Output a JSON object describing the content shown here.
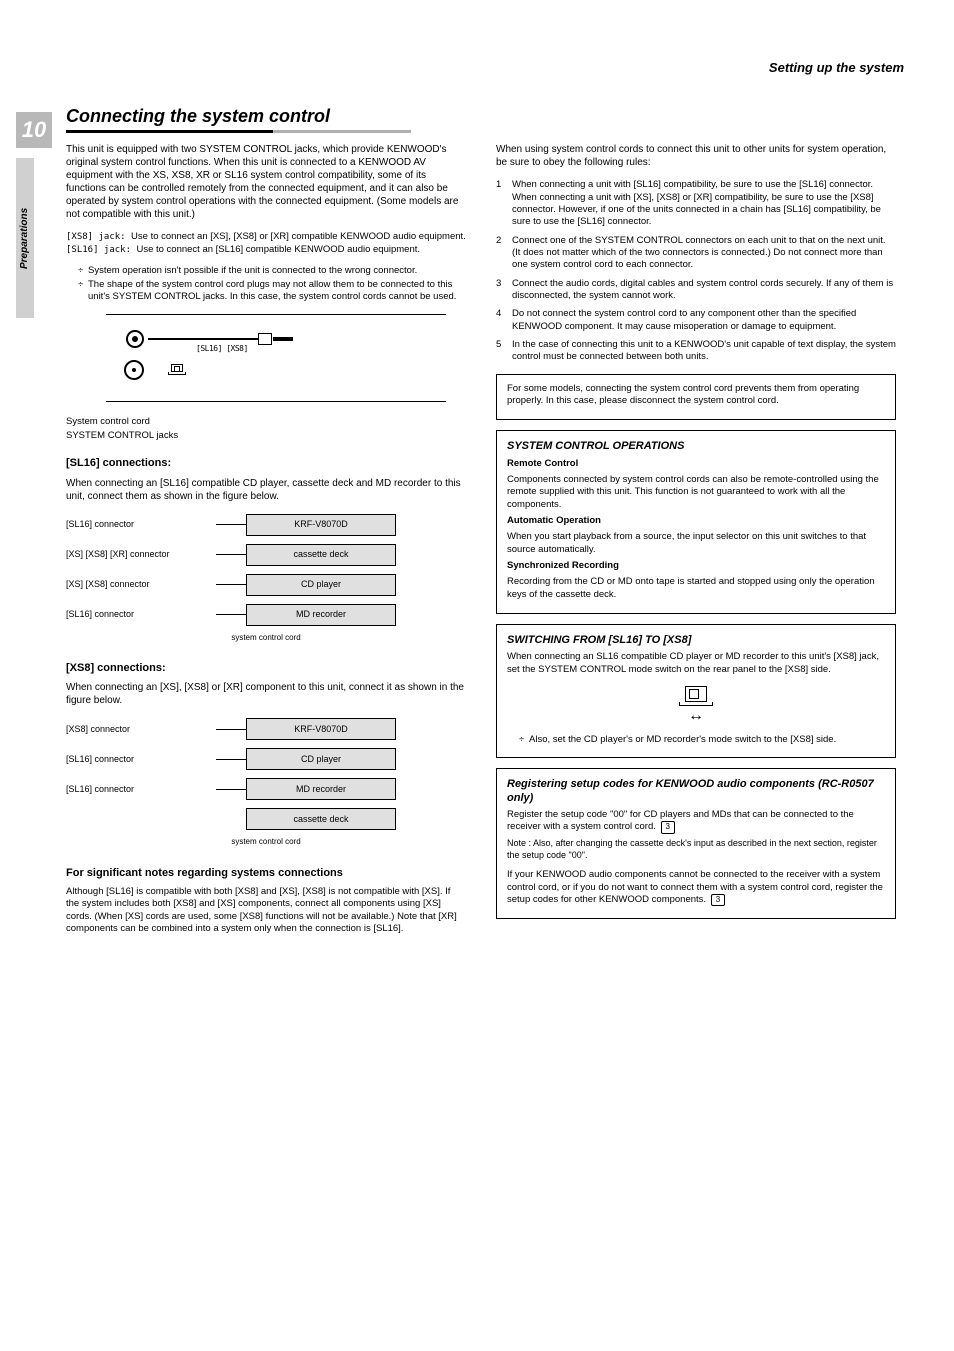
{
  "header": {
    "section_name": "Setting up the system"
  },
  "page_number": "10",
  "sidebar_tab": "Preparations",
  "title": "Connecting the system control",
  "left_col": {
    "intro": "This unit is equipped with two SYSTEM CONTROL jacks, which provide KENWOOD's original system control functions. When this unit is connected to a KENWOOD AV equipment with the XS, XS8, XR or SL16 system control compatibility, some of its functions can be controlled remotely from the connected equipment, and it can also be operated by system control operations with the connected equipment. (Some models are not compatible with this unit.)",
    "jack1_label": "[XS8] jack: ",
    "jack1_text": "Use to connect an [XS], [XS8] or [XR] compatible KENWOOD audio equipment.",
    "jack2_label": "[SL16] jack: ",
    "jack2_text": "Use to connect an [SL16] compatible KENWOOD audio equipment.",
    "jack_bullet1": "System operation isn't possible if the unit is connected to the wrong connector.",
    "jack_bullet2": "The shape of the system control cord plugs may not allow them to be connected to this unit's SYSTEM CONTROL jacks. In this case, the system control cords cannot be used.",
    "fig_jackbox": "[SL16] [XS8]",
    "fig_caption": "System control cord",
    "fig_label": "SYSTEM CONTROL jacks",
    "sl16_title": "[SL16] connections:",
    "sl16_intro": "When connecting an [SL16] compatible CD player, cassette deck and MD recorder to this unit, connect them as shown in the figure below.",
    "sl16_r1_label": "[SL16] connector",
    "sl16_r1_box": "KRF-V8070D",
    "sl16_r2_label1": "[XS] [XS8] [XR]",
    "sl16_r2_label2": " connector",
    "sl16_r2_box": "cassette deck",
    "sl16_r3_label1": "[XS] [XS8]",
    "sl16_r3_label2": " connector",
    "sl16_r3_box": "CD player",
    "sl16_r4_label": "[SL16] connector",
    "sl16_r4_box": "MD recorder",
    "sl16_tiny": "system control cord",
    "xs8_title": "[XS8] connections:",
    "xs8_intro": "When connecting an [XS], [XS8] or [XR] component to this unit, connect it as shown in the figure below.",
    "xs8_r1_label": "[XS8] connector",
    "xs8_r1_box": "KRF-V8070D",
    "xs8_r2_label": "[SL16] connector",
    "xs8_r2_box": "CD player",
    "xs8_r3_label": "[SL16] connector",
    "xs8_r3_box": "MD recorder",
    "xs8_r4_box": "cassette deck",
    "sig_sub": "For significant notes regarding systems connections",
    "sig_text": "Although [SL16] is compatible with both [XS8] and [XS], [XS8] is not compatible with [XS]. If the system includes both [XS8] and [XS] components, connect all components using [XS] cords. (When [XS] cords are used, some [XS8] functions will not be available.) Note that [XR] components can be combined into a system only when the connection is [SL16]."
  },
  "right_col": {
    "rules_intro": "When using system control cords to connect this unit to other units for system operation, be sure to obey the following rules:",
    "rule1_num": "1",
    "rule1": "When connecting a unit with [SL16] compatibility, be sure to use the [SL16] connector. When connecting a unit with [XS], [XS8] or [XR] compatibility, be sure to use the [XS8] connector. However, if one of the units connected in a chain has [SL16] compatibility, be sure to use the [SL16] connector.",
    "rule2_num": "2",
    "rule2": "Connect one of the SYSTEM CONTROL connectors on each unit to that on the next unit. (It does not matter which of the two connectors is connected.) Do not connect more than one system control cord to each connector.",
    "rule3_num": "3",
    "rule3": "Connect the audio cords, digital cables and system control cords securely. If any of them is disconnected, the system cannot work.",
    "rule4_num": "4",
    "rule4": "Do not connect the system control cord to any component other than the specified KENWOOD component. It may cause misoperation or damage to equipment.",
    "rule5_num": "5",
    "rule5": "In the case of connecting this unit to a KENWOOD's unit capable of text display, the system control must be connected between both units.",
    "short_box": "For some models, connecting the system control cord prevents them from operating properly. In this case, please disconnect the system control cord.",
    "sysop_title": "SYSTEM CONTROL OPERATIONS",
    "sysop_remote_h": "Remote Control",
    "sysop_remote": "Components connected by system control cords can also be remote-controlled using the remote supplied with this unit. This function is not guaranteed to work with all the components.",
    "sysop_auto_h": "Automatic Operation",
    "sysop_auto": "When you start playback from a source, the input selector on this unit switches to that source automatically.",
    "sysop_sync_h": "Synchronized Recording",
    "sysop_sync": "Recording from the CD or MD onto tape is started and stopped using only the operation keys of the cassette deck.",
    "switch_title": "SWITCHING FROM [SL16] TO [XS8]",
    "switch_text1": "When connecting an SL16 compatible CD player or MD recorder to this unit's [XS8] jack, set the SYSTEM CONTROL mode switch on the rear panel to the [XS8] side.",
    "switch_text2": "Also, set the CD player's or MD recorder's mode switch to the [XS8] side.",
    "reg_title": "Registering setup codes for KENWOOD audio components (RC-R0507 only)",
    "reg_p1": "Register the setup code \"00\" for CD players and MDs that can be connected to the receiver with a system control cord. ",
    "reg_ref1": "3",
    "reg_note_label": "Note : ",
    "reg_note": "Also, after changing the cassette deck's input as described in the next section, register the setup code \"00\".",
    "reg_p2": "If your KENWOOD audio components cannot be connected to the receiver with a system control cord, or if you do not want to connect them with a system control cord, register the setup codes for other KENWOOD components. ",
    "reg_ref2": "3"
  }
}
